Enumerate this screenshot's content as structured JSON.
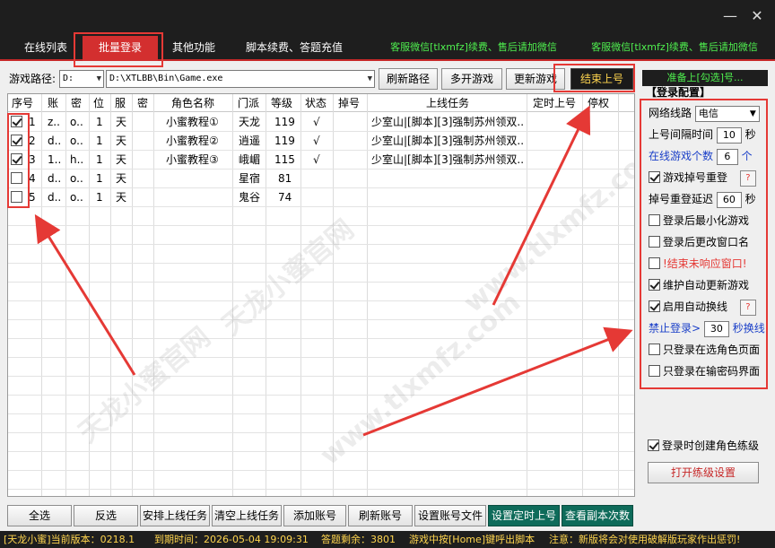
{
  "window": {
    "minimize_icon": "—",
    "close_icon": "✕"
  },
  "tabs": [
    {
      "label": "在线列表"
    },
    {
      "label": "批量登录"
    },
    {
      "label": "其他功能"
    },
    {
      "label": "脚本续费、答题充值"
    },
    {
      "label": "客服微信[tlxmfz]续费、售后请加微信"
    },
    {
      "label": "客服微信[tlxmfz]续费、售后请加微信"
    }
  ],
  "path": {
    "label": "游戏路径:",
    "drive": "D:",
    "value": "D:\\XTLBB\\Bin\\Game.exe",
    "refresh_button": "刷新路径",
    "multi_button": "多开游戏",
    "update_button": "更新游戏",
    "end_button": "结束上号"
  },
  "table": {
    "headers": [
      "序号",
      "账",
      "密",
      "位",
      "服",
      "密",
      "角色名称",
      "门派",
      "等级",
      "状态",
      "掉号",
      "上线任务",
      "定时上号",
      "停权"
    ],
    "rows": [
      {
        "checked": true,
        "idx": "1",
        "acct": "z..",
        "pwd": "o..",
        "pos": "1",
        "srv": "天",
        "name": "小蜜教程①",
        "school": "天龙",
        "level": "119",
        "state": "√",
        "task": "少室山|[脚本][3]强制苏州领双..."
      },
      {
        "checked": true,
        "idx": "2",
        "acct": "d..",
        "pwd": "o..",
        "pos": "1",
        "srv": "天",
        "name": "小蜜教程②",
        "school": "逍遥",
        "level": "119",
        "state": "√",
        "task": "少室山|[脚本][3]强制苏州领双..."
      },
      {
        "checked": true,
        "idx": "3",
        "acct": "1..",
        "pwd": "h..",
        "pos": "1",
        "srv": "天",
        "name": "小蜜教程③",
        "school": "峨嵋",
        "level": "115",
        "state": "√",
        "task": "少室山|[脚本][3]强制苏州领双..."
      },
      {
        "checked": false,
        "idx": "4",
        "acct": "d..",
        "pwd": "o..",
        "pos": "1",
        "srv": "天",
        "name": "",
        "school": "星宿",
        "level": "81",
        "state": "",
        "task": ""
      },
      {
        "checked": false,
        "idx": "5",
        "acct": "d..",
        "pwd": "o..",
        "pos": "1",
        "srv": "天",
        "name": "",
        "school": "鬼谷",
        "level": "74",
        "state": "",
        "task": ""
      }
    ]
  },
  "right": {
    "top_label": "准备上[勾选]号...",
    "section_title": "【登录配置】",
    "net_label": "网络线路",
    "net_value": "电信",
    "interval_label": "上号间隔时间",
    "interval_value": "10",
    "interval_unit": "秒",
    "online_label": "在线游戏个数",
    "online_value": "6",
    "online_unit": "个",
    "relogin_label": "游戏掉号重登",
    "relogin_delay_label": "掉号重登延迟",
    "relogin_delay_value": "60",
    "relogin_delay_unit": "秒",
    "opt_min": "登录后最小化游戏",
    "opt_rename": "登录后更改窗口名",
    "opt_kill": "!结束未响应窗口!",
    "opt_update": "维护自动更新游戏",
    "opt_switch": "启用自动换线",
    "ban_label": "禁止登录>",
    "ban_value": "30",
    "ban_unit": "秒换线",
    "opt_rolepage": "只登录在选角色页面",
    "opt_pwdpage": "只登录在输密码界面",
    "opt_create": "登录时创建角色练级",
    "open_level_button": "打开练级设置",
    "help": "?"
  },
  "bottom_buttons": [
    "全选",
    "反选",
    "安排上线任务",
    "清空上线任务",
    "添加账号",
    "刷新账号",
    "设置账号文件",
    "设置定时上号",
    "查看副本次数"
  ],
  "status": {
    "version": "[天龙小蜜]当前版本：0218.1",
    "expire": "到期时间：2026-05-04 19:09:31",
    "answers": "答题剩余：3801",
    "hotkey": "游戏中按[Home]键呼出脚本",
    "notice": "注意：新版将会对使用破解版玩家作出惩罚!"
  },
  "watermark": {
    "cn": "天龙小蜜官网",
    "url": "www.tlxmfz.com"
  }
}
